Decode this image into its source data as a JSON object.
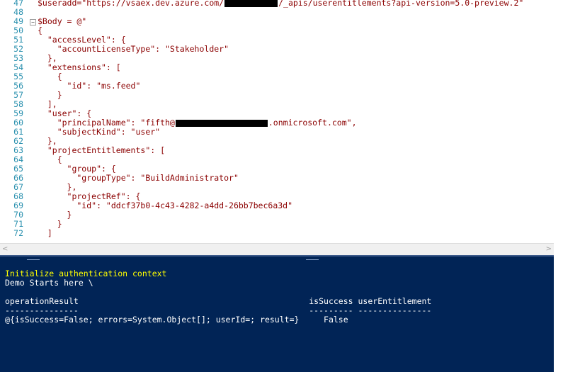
{
  "editor": {
    "lines": [
      {
        "num": "47",
        "text": "$useradd=\"https://vsaex.dev.azure.com/",
        "redact": true,
        "after": "/_apis/userentitlements?api-version=5.0-preview.2\""
      },
      {
        "num": "48",
        "text": ""
      },
      {
        "num": "49",
        "text": "$Body = @\"",
        "fold": "−"
      },
      {
        "num": "50",
        "text": "{"
      },
      {
        "num": "51",
        "text": "  \"accessLevel\": {"
      },
      {
        "num": "52",
        "text": "    \"accountLicenseType\": \"Stakeholder\""
      },
      {
        "num": "53",
        "text": "  },"
      },
      {
        "num": "54",
        "text": "  \"extensions\": ["
      },
      {
        "num": "55",
        "text": "    {"
      },
      {
        "num": "56",
        "text": "      \"id\": \"ms.feed\""
      },
      {
        "num": "57",
        "text": "    }"
      },
      {
        "num": "58",
        "text": "  ],"
      },
      {
        "num": "59",
        "text": "  \"user\": {"
      },
      {
        "num": "60",
        "text": "    \"principalName\": \"fifth@",
        "redact": true,
        "after": ".onmicrosoft.com\","
      },
      {
        "num": "61",
        "text": "    \"subjectKind\": \"user\""
      },
      {
        "num": "62",
        "text": "  },"
      },
      {
        "num": "63",
        "text": "  \"projectEntitlements\": ["
      },
      {
        "num": "64",
        "text": "    {"
      },
      {
        "num": "65",
        "text": "      \"group\": {"
      },
      {
        "num": "66",
        "text": "        \"groupType\": \"BuildAdministrator\""
      },
      {
        "num": "67",
        "text": "      },"
      },
      {
        "num": "68",
        "text": "      \"projectRef\": {"
      },
      {
        "num": "69",
        "text": "        \"id\": \"ddcf37b0-4c43-4282-a4dd-26bb7bec6a3d\""
      },
      {
        "num": "70",
        "text": "      }"
      },
      {
        "num": "71",
        "text": "    }"
      },
      {
        "num": "72",
        "text": "  ]"
      }
    ]
  },
  "console": {
    "lines": [
      {
        "text": "Initialize authentication context",
        "color": "yellow"
      },
      {
        "text": "Demo Starts here \\",
        "color": "white"
      },
      {
        "text": "",
        "color": "white"
      },
      {
        "text": "operationResult                                               isSuccess userEntitlement",
        "color": "white"
      },
      {
        "text": "---------------                                               --------- ---------------",
        "color": "white"
      },
      {
        "text": "@{isSuccess=False; errors=System.Object[]; userId=; result=}     False",
        "color": "white"
      }
    ]
  },
  "scrollbar": {
    "left_arrow": "<",
    "right_arrow": ">"
  },
  "colors": {
    "console_bg": "#012456",
    "editor_string": "#8b0000",
    "line_number": "#2b91af"
  }
}
